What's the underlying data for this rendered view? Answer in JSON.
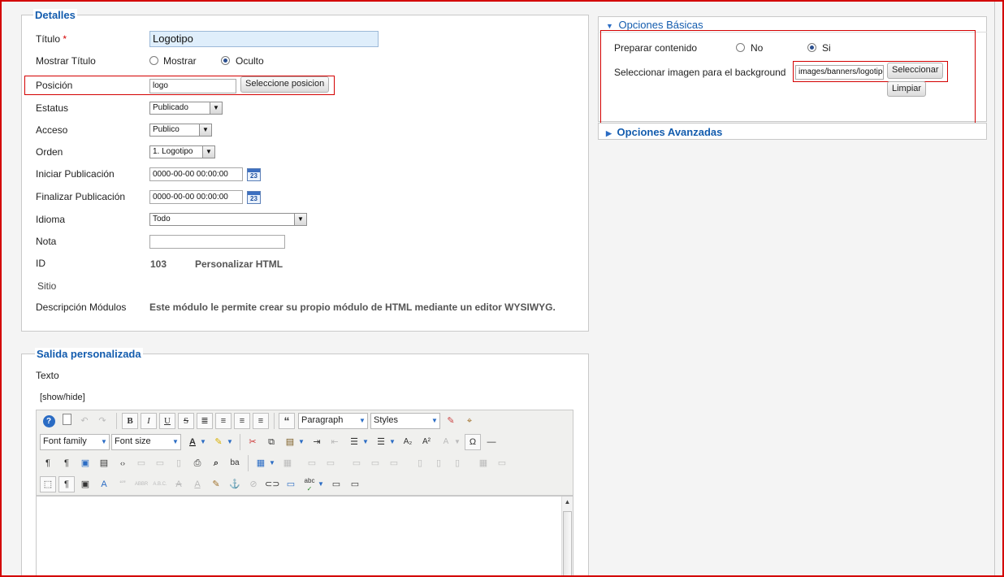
{
  "detalles": {
    "legend": "Detalles",
    "titulo_label": "Título",
    "titulo_required": "*",
    "titulo_value": "Logotipo",
    "mostrar_titulo_label": "Mostrar Título",
    "mostrar_option": "Mostrar",
    "oculto_option": "Oculto",
    "mostrar_titulo_selected": "Oculto",
    "posicion_label": "Posición",
    "posicion_value": "logo",
    "posicion_button": "Seleccione posicion",
    "estatus_label": "Estatus",
    "estatus_value": "Publicado",
    "acceso_label": "Acceso",
    "acceso_value": "Publico",
    "orden_label": "Orden",
    "orden_value": "1. Logotipo",
    "iniciar_label": "Iniciar Publicación",
    "iniciar_value": "0000-00-00 00:00:00",
    "finalizar_label": "Finalizar Publicación",
    "finalizar_value": "0000-00-00 00:00:00",
    "calendar_day": "23",
    "idioma_label": "Idioma",
    "idioma_value": "Todo",
    "nota_label": "Nota",
    "nota_value": "",
    "id_label": "ID",
    "id_value": "103",
    "tipo_value": "Personalizar HTML",
    "sitio_label": "Sitio",
    "descripcion_label": "Descripción Módulos",
    "descripcion_value": "Este módulo le permite crear su propio módulo de HTML mediante un editor WYSIWYG."
  },
  "salida": {
    "legend": "Salida personalizada",
    "texto_label": "Texto",
    "toggle_link": "[show/hide]",
    "editor": {
      "format_select": "Paragraph",
      "styles_select": "Styles",
      "font_family_select": "Font family",
      "font_size_select": "Font size",
      "quote_glyph": "“",
      "bold": "B",
      "italic": "I",
      "underline": "U",
      "strike": "S",
      "omega": "Ω",
      "subscript": "A₂",
      "superscript": "A²",
      "abc": "abc",
      "abbr": "ABBR",
      "acronym": "A.B.C.",
      "quotes": "“”"
    }
  },
  "opciones_basicas": {
    "legend": "Opciones Básicas",
    "preparar_label": "Preparar contenido",
    "no_option": "No",
    "si_option": "Si",
    "preparar_selected": "Si",
    "imagen_label": "Seleccionar imagen para el background",
    "imagen_value": "images/banners/logotipo",
    "seleccionar_button": "Seleccionar",
    "limpiar_button": "Limpiar"
  },
  "opciones_avanzadas": {
    "legend": "Opciones Avanzadas"
  },
  "colors": {
    "accent": "#135cae",
    "highlight_border": "#d40000",
    "title_input_bg": "#dfeefb"
  }
}
